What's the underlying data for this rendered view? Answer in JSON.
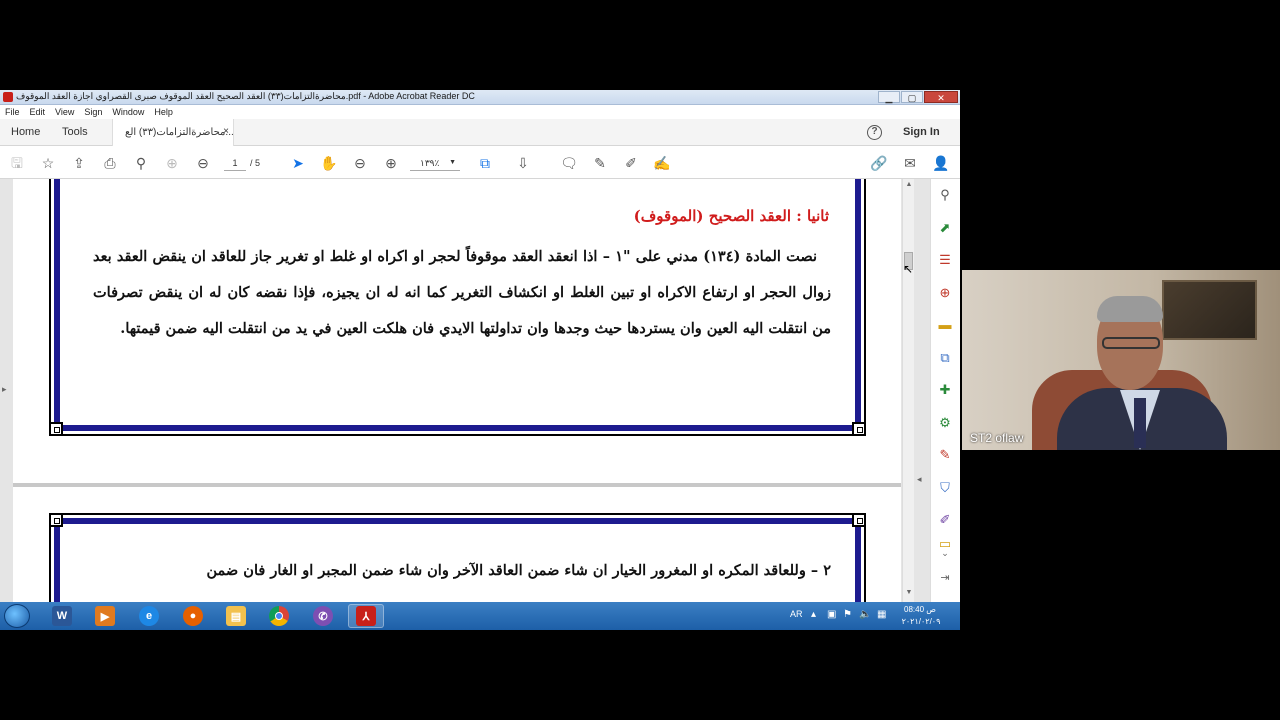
{
  "window": {
    "title": "محاضرةالتزامات(٣٣) العقد الصحيح العقد الموقوف صبرى القصراوي  اجازة العقد الموقوف.pdf - Adobe Acrobat Reader DC",
    "buttons": {
      "minimize": "▁",
      "maximize": "▢",
      "close": "✕"
    }
  },
  "menu": [
    "File",
    "Edit",
    "View",
    "Sign",
    "Window",
    "Help"
  ],
  "tabs": {
    "home": "Home",
    "tools": "Tools",
    "document": "محاضرةالتزامات(٣٣) الع...",
    "close": "×"
  },
  "header": {
    "help": "?",
    "sign_in": "Sign In"
  },
  "toolbar": {
    "page_current": "1",
    "page_total": "/ 5",
    "zoom": "١٣٩٪",
    "zoom_caret": "▼"
  },
  "document": {
    "page1": {
      "heading": "ثانيا : العقد الصحيح  (الموقوف)",
      "body": "نصت المادة (١٣٤) مدني على \"١ – اذا انعقد العقد موقوفاً لحجر او اكراه او غلط او تغرير جاز للعاقد ان ينقض العقد بعد زوال الحجر او ارتفاع الاكراه او تبين الغلط او انكشاف التغرير كما انه له ان يجيزه، فإذا نقضه كان له ان ينقض تصرفات من انتقلت اليه العين وان يستردها حيث وجدها وان تداولتها الايدي فان هلكت العين في يد من انتقلت اليه ضمن قيمتها."
    },
    "page2": {
      "body": "٢ – وللعاقد المكره او المغرور الخيار ان شاء ضمن العاقد الآخر وان شاء ضمن المجبر او الغار فان ضمن"
    }
  },
  "taskbar": {
    "language": "AR",
    "time": "ص 08:40",
    "date": "٢٠٢١/٠٢/٠٩"
  },
  "webcam": {
    "label": "ST2 oflaw"
  }
}
